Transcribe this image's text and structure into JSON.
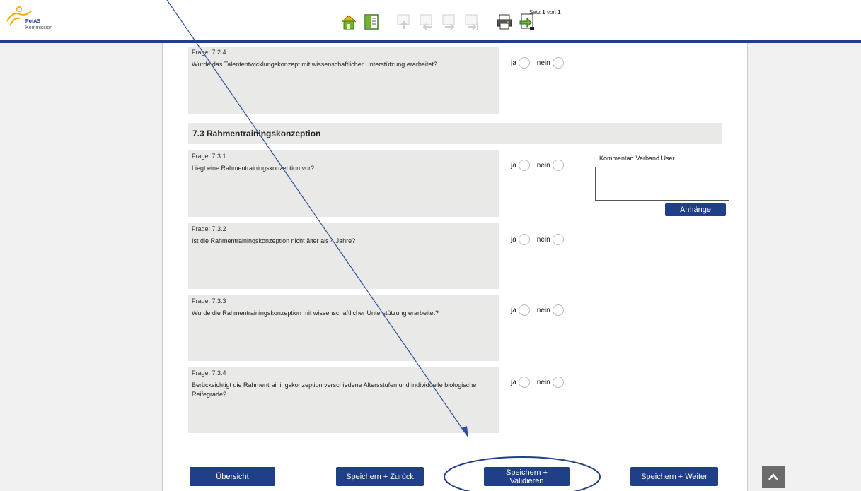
{
  "header": {
    "logo_name": "PotAS",
    "logo_sub": "Kommission",
    "toolbar_icons": [
      "home-icon",
      "overview-icon",
      "first-record-icon",
      "previous-record-icon",
      "next-record-icon",
      "last-record-icon",
      "print-icon",
      "export-icon"
    ],
    "record_prefix": "Satz",
    "record_current": "1",
    "record_mid": "von",
    "record_total": "1"
  },
  "questions": [
    {
      "num": "Frage: 7.2.4",
      "text": "Wurde das Talententwicklungskonzept mit wissenschaftlicher Unterstützung erarbeitet?",
      "yes": "ja",
      "no": "nein"
    },
    {
      "num": "Frage: 7.3.1",
      "text": "Liegt eine Rahmentrainingskonzeption vor?",
      "yes": "ja",
      "no": "nein"
    },
    {
      "num": "Frage: 7.3.2",
      "text": "Ist die Rahmentrainingskonzeption nicht älter als 4 Jahre?",
      "yes": "ja",
      "no": "nein"
    },
    {
      "num": "Frage: 7.3.3",
      "text": "Wurde die Rahmentrainingskonzeption mit wissenschaftlicher Unterstützung erarbeitet?",
      "yes": "ja",
      "no": "nein"
    },
    {
      "num": "Frage: 7.3.4",
      "text": "Berücksichtigt die Rahmentrainingskonzeption verschiedene Altersstufen und individuelle biologische Reifegrade?",
      "yes": "ja",
      "no": "nein"
    }
  ],
  "section_title": "7.3 Rahmentrainingskonzeption",
  "comment": {
    "label": "Kommentar: Verband User",
    "attachments_label": "Anhänge"
  },
  "buttons": {
    "overview": "Übersicht",
    "save_back": "Speichern + Zurück",
    "save_validate_1": "Speichern +",
    "save_validate_2": "Validieren",
    "save_next": "Speichern + Weiter"
  },
  "colors": {
    "brand": "#1f3f86",
    "logo_accent": "#f5a800"
  }
}
